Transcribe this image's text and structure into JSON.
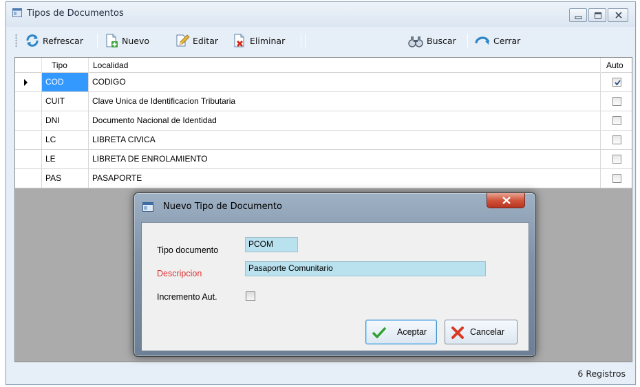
{
  "window": {
    "title": "Tipos de Documentos",
    "controls": [
      "minimize",
      "maximize",
      "close"
    ]
  },
  "toolbar": {
    "refresh_label": "Refrescar",
    "new_label": "Nuevo",
    "edit_label": "Editar",
    "delete_label": "Eliminar",
    "search_label": "Buscar",
    "close_label": "Cerrar"
  },
  "grid": {
    "columns": {
      "tipo": "Tipo",
      "localidad": "Localidad",
      "auto": "Auto"
    },
    "rows": [
      {
        "tipo": "COD",
        "localidad": "CODIGO",
        "auto": true,
        "selected": true
      },
      {
        "tipo": "CUIT",
        "localidad": "Clave Unica de Identificacion Tributaria",
        "auto": false,
        "selected": false
      },
      {
        "tipo": "DNI",
        "localidad": "Documento Nacional de Identidad",
        "auto": false,
        "selected": false
      },
      {
        "tipo": "LC",
        "localidad": "LIBRETA CIVICA",
        "auto": false,
        "selected": false
      },
      {
        "tipo": "LE",
        "localidad": "LIBRETA DE ENROLAMIENTO",
        "auto": false,
        "selected": false
      },
      {
        "tipo": "PAS",
        "localidad": "PASAPORTE",
        "auto": false,
        "selected": false
      }
    ]
  },
  "status": {
    "record_count": "6 Registros"
  },
  "dialog": {
    "title": "Nuevo Tipo de Documento",
    "tipo_label": "Tipo documento",
    "tipo_value": "PCOM",
    "descripcion_label": "Descripcion",
    "descripcion_value": "Pasaporte Comunitario",
    "incremento_label": "Incremento Aut.",
    "incremento_checked": false,
    "accept_label": "Aceptar",
    "cancel_label": "Cancelar"
  },
  "colors": {
    "selection": "#3399ff",
    "field_background": "#b9e1ee",
    "required_label": "#e03030",
    "grid_empty_area": "#ababab"
  }
}
